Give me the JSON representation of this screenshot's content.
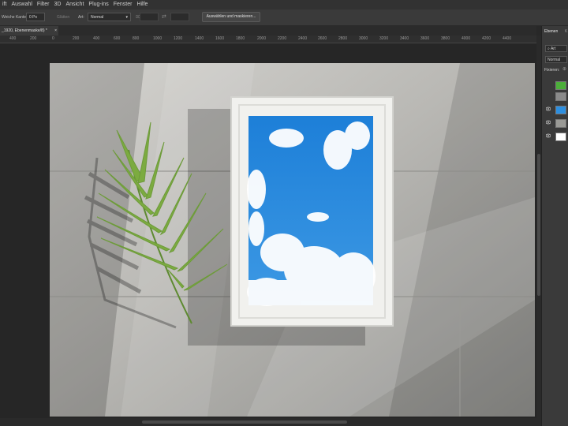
{
  "menubar": {
    "items": [
      "ift",
      "Auswahl",
      "Filter",
      "3D",
      "Ansicht",
      "Plug-ins",
      "Fenster",
      "Hilfe"
    ]
  },
  "options_bar": {
    "feather_label": "Weiche Kante:",
    "feather_value": "0 Px",
    "smooth_label": "Glätten",
    "style_label": "Art:",
    "style_value": "Normal",
    "select_mask_label": "Auswählen und maskieren..."
  },
  "document_tab": {
    "title": "_1920, Ebenenmaske/8) *",
    "close": "×"
  },
  "ruler": {
    "labels": [
      "400",
      "200",
      "0",
      "200",
      "400",
      "600",
      "800",
      "1000",
      "1200",
      "1400",
      "1600",
      "1800",
      "2000",
      "2200",
      "2400",
      "2600",
      "2800",
      "3000",
      "3200",
      "3400",
      "3600",
      "3800",
      "4000",
      "4200",
      "4400"
    ]
  },
  "panel": {
    "tab_active": "Ebenen",
    "tab_other": "K",
    "search_placeholder": "Art",
    "blend_mode": "Normal",
    "lock_label": "Fixieren:"
  },
  "colors": {
    "sky": "#1e7fd6",
    "leaf": "#6d9b3a",
    "frame": "#f1f1ee"
  }
}
